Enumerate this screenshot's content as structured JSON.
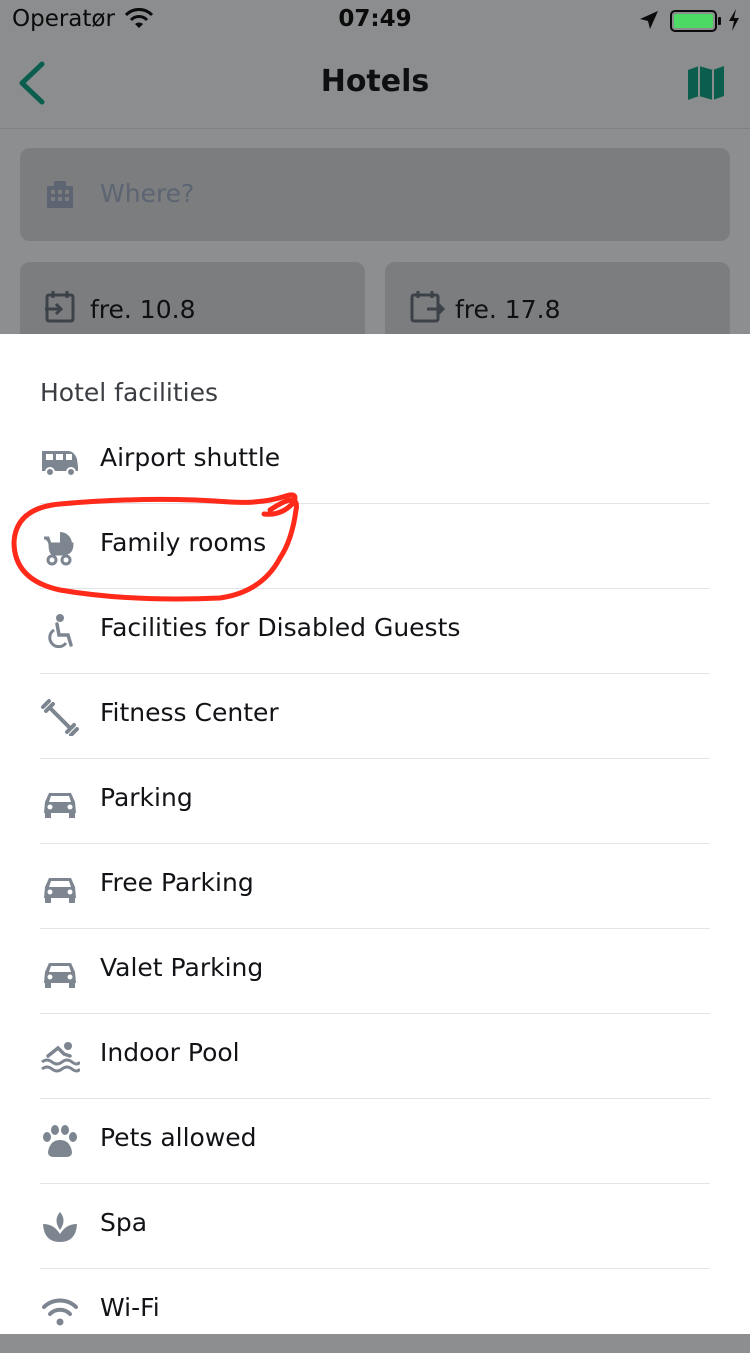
{
  "status_bar": {
    "carrier": "Operatør",
    "time": "07:49"
  },
  "nav": {
    "title": "Hotels",
    "back_icon": "chevron-left-icon",
    "map_icon": "map-icon",
    "accent": "#0b5e4e"
  },
  "search": {
    "placeholder": "Where?",
    "icon": "building-icon"
  },
  "dates": {
    "checkin": "fre. 10.8",
    "checkout": "fre. 17.8"
  },
  "sheet": {
    "heading": "Hotel facilities",
    "items": [
      {
        "label": "Airport shuttle",
        "icon": "shuttle-van-icon"
      },
      {
        "label": "Family rooms",
        "icon": "stroller-icon"
      },
      {
        "label": "Facilities for Disabled Guests",
        "icon": "wheelchair-icon"
      },
      {
        "label": "Fitness Center",
        "icon": "dumbbell-icon"
      },
      {
        "label": "Parking",
        "icon": "car-icon"
      },
      {
        "label": "Free Parking",
        "icon": "car-icon"
      },
      {
        "label": "Valet Parking",
        "icon": "car-icon"
      },
      {
        "label": "Indoor Pool",
        "icon": "swimmer-icon"
      },
      {
        "label": "Pets allowed",
        "icon": "paw-icon"
      },
      {
        "label": "Spa",
        "icon": "lotus-icon"
      },
      {
        "label": "Wi-Fi",
        "icon": "wifi-icon"
      }
    ]
  },
  "colors": {
    "icon_gray": "#7d8591",
    "annotation_red": "#ff2a1a",
    "battery_green": "#4cd964"
  }
}
